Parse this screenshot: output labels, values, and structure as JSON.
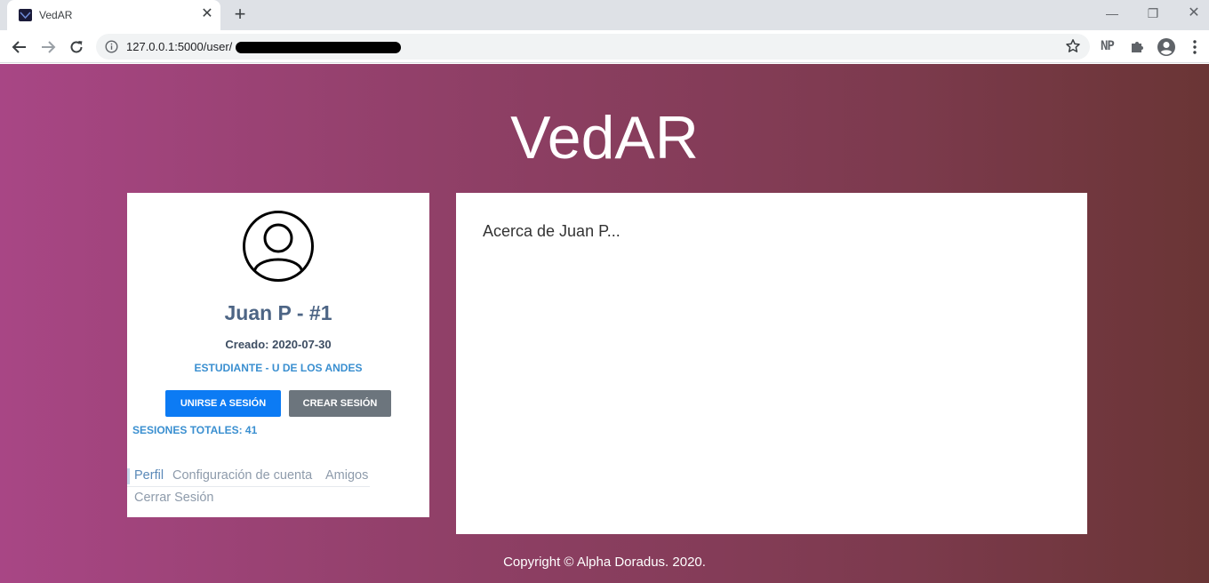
{
  "browser": {
    "tab_title": "VedAR",
    "tab_close": "✕",
    "new_tab": "+",
    "url": "127.0.0.1:5000/user/",
    "extension_label": "NP",
    "window_controls": {
      "minimize": "—",
      "maximize": "❐",
      "close": "✕"
    }
  },
  "page": {
    "brand": "VedAR",
    "profile": {
      "name": "Juan P - #1",
      "created": "Creado: 2020-07-30",
      "role": "ESTUDIANTE - U DE LOS ANDES",
      "join_button": "UNIRSE A SESIÓN",
      "create_button": "CREAR SESIÓN",
      "sessions_total": "SESIONES TOTALES: 41",
      "nav": {
        "profile": "Perfil",
        "account_settings": "Configuración de cuenta",
        "friends": "Amigos",
        "logout": "Cerrar Sesión"
      }
    },
    "about": {
      "title": "Acerca de Juan P..."
    },
    "footer": "Copyright © Alpha Doradus. 2020."
  },
  "colors": {
    "gradient_start": "#a84685",
    "gradient_end": "#6a3535",
    "join_button": "#0c7bf4",
    "create_button": "#6c757d",
    "accent_text": "#3a8fd0"
  }
}
